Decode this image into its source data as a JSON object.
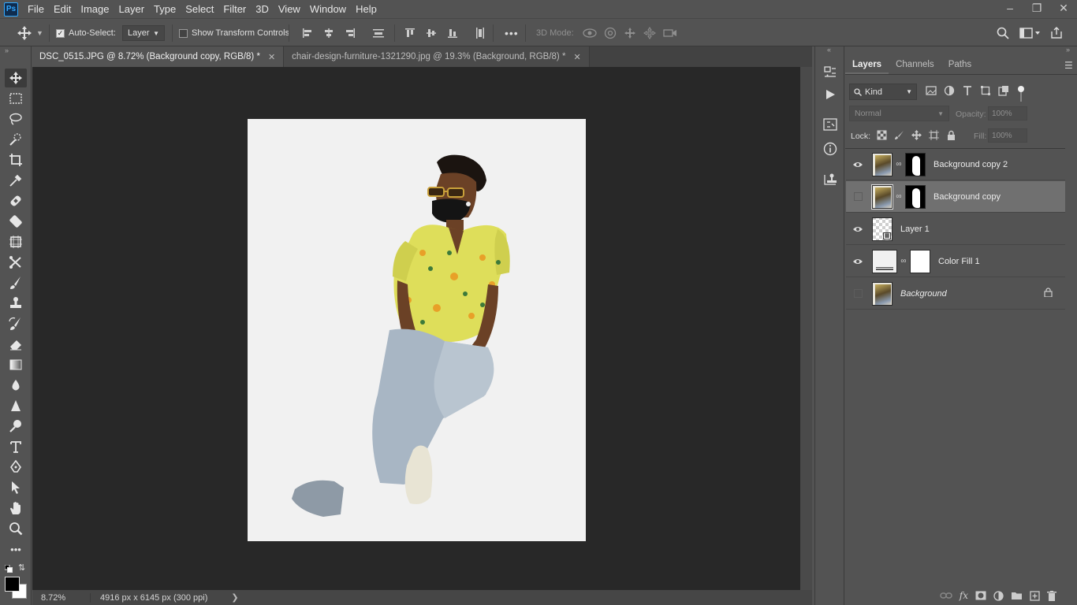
{
  "app": {
    "logo": "Ps"
  },
  "menu": [
    "File",
    "Edit",
    "Image",
    "Layer",
    "Type",
    "Select",
    "Filter",
    "3D",
    "View",
    "Window",
    "Help"
  ],
  "options": {
    "auto_select_label": "Auto-Select:",
    "auto_select_checked": true,
    "auto_select_value": "Layer",
    "transform_controls_label": "Show Transform Controls",
    "transform_controls_checked": false,
    "more_label": "•••",
    "mode_3d_label": "3D Mode:"
  },
  "tabs": [
    {
      "label": "DSC_0515.JPG @ 8.72% (Background copy, RGB/8) *",
      "active": true
    },
    {
      "label": "chair-design-furniture-1321290.jpg @ 19.3% (Background, RGB/8) *",
      "active": false
    }
  ],
  "status": {
    "zoom": "8.72%",
    "doc_info": "4916 px x 6145 px (300 ppi)"
  },
  "panel": {
    "tabs": [
      "Layers",
      "Channels",
      "Paths"
    ],
    "filter_kind": "Kind",
    "blend_mode": "Normal",
    "opacity_label": "Opacity:",
    "opacity_value": "100%",
    "lock_label": "Lock:",
    "fill_label": "Fill:",
    "fill_value": "100%",
    "layers": [
      {
        "name": "Background copy 2",
        "visible": true,
        "selected": false,
        "has_mask": true
      },
      {
        "name": "Background copy",
        "visible": false,
        "selected": true,
        "has_mask": true
      },
      {
        "name": "Layer 1",
        "visible": true,
        "selected": false,
        "has_mask": false
      },
      {
        "name": "Color Fill 1",
        "visible": true,
        "selected": false,
        "has_mask": true
      },
      {
        "name": "Background",
        "visible": false,
        "selected": false,
        "has_mask": false,
        "locked": true
      }
    ]
  },
  "colors": {
    "accent": "#31a8ff",
    "canvas_bg": "#282828",
    "doc_bg": "#f1f1f1",
    "shirt": "#dede5a"
  }
}
